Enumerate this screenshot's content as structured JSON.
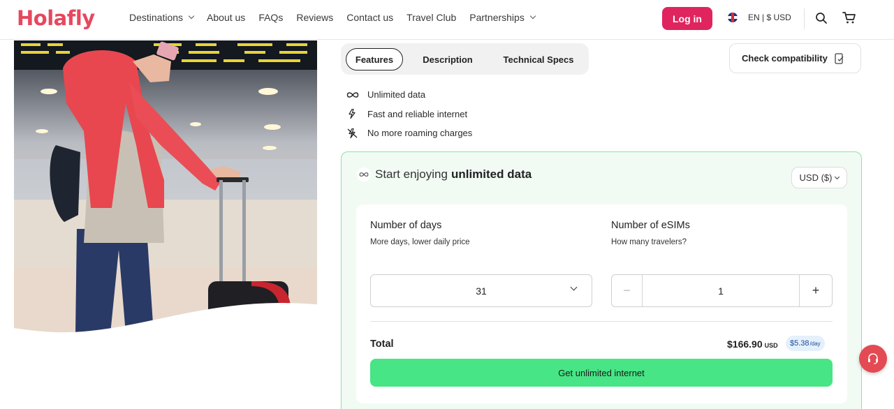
{
  "header": {
    "logo": "Holafly",
    "nav": [
      {
        "label": "Destinations",
        "dropdown": true
      },
      {
        "label": "About us",
        "dropdown": false
      },
      {
        "label": "FAQs",
        "dropdown": false
      },
      {
        "label": "Reviews",
        "dropdown": false
      },
      {
        "label": "Contact us",
        "dropdown": false
      },
      {
        "label": "Travel Club",
        "dropdown": false
      },
      {
        "label": "Partnerships",
        "dropdown": true
      }
    ],
    "login_label": "Log in",
    "language_label": "EN | $ USD",
    "icons": [
      "uk-flag-icon",
      "search-icon",
      "cart-icon"
    ]
  },
  "tabs": [
    {
      "label": "Features",
      "active": true
    },
    {
      "label": "Description",
      "active": false
    },
    {
      "label": "Technical Specs",
      "active": false
    }
  ],
  "check_compatibility_label": "Check compatibility",
  "features": [
    {
      "icon": "infinity-icon",
      "label": "Unlimited data"
    },
    {
      "icon": "lightning-icon",
      "label": "Fast and reliable internet"
    },
    {
      "icon": "no-roaming-icon",
      "label": "No more roaming charges"
    }
  ],
  "plan": {
    "heading_prefix": "Start enjoying",
    "heading_bold": "unlimited data",
    "currency_label": "USD ($)",
    "days_label": "Number of days",
    "days_sub": "More days, lower daily price",
    "days_value": "31",
    "esims_label": "Number of eSIMs",
    "esims_sub": "How many travelers?",
    "esims_value": "1",
    "minus_label": "−",
    "plus_label": "+",
    "total_label": "Total",
    "total_price": "$166.90",
    "total_currency": "USD",
    "per_day_price": "$5.38",
    "per_day_unit": "/day",
    "cta_label": "Get unlimited internet"
  },
  "colors": {
    "brand": "#e6485f",
    "login_bg": "#e0245e",
    "cta_bg": "#47e585",
    "card_border": "#8be2a6",
    "card_bg": "#f1fbf4"
  }
}
